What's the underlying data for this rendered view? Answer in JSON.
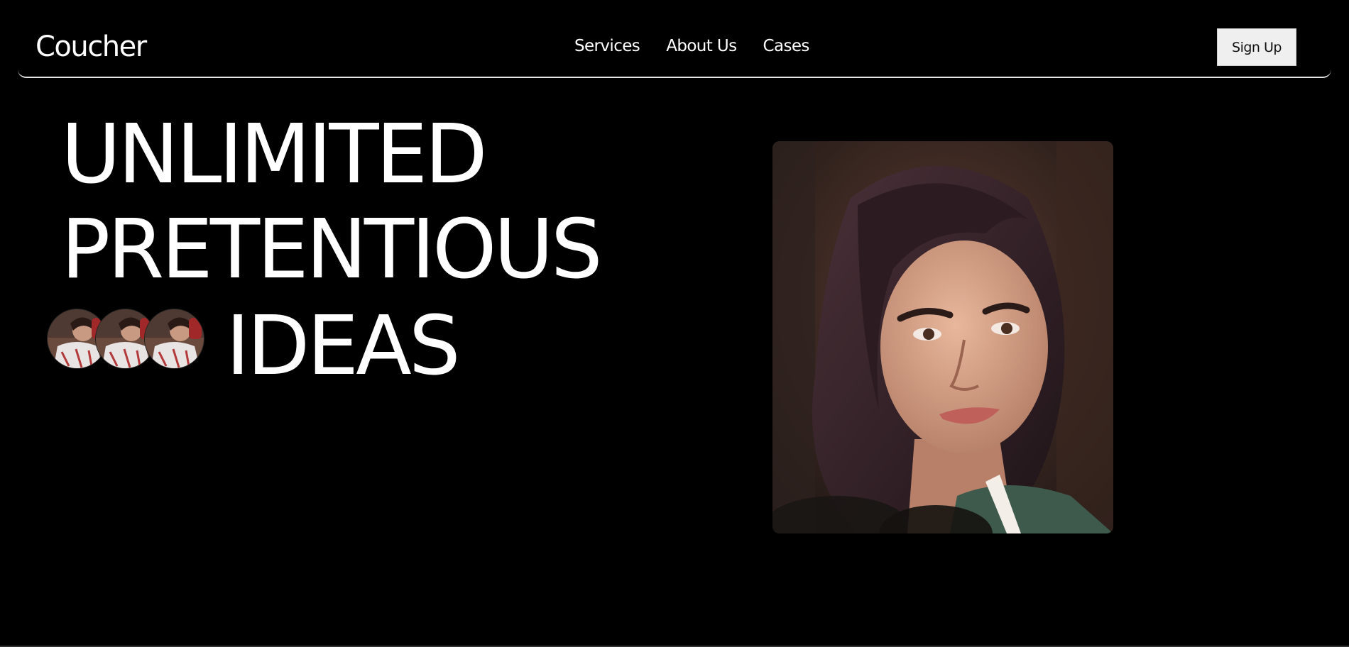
{
  "header": {
    "logo": "Coucher",
    "nav": [
      "Services",
      "About Us",
      "Cases"
    ],
    "signup_label": "Sign Up"
  },
  "hero": {
    "lines": [
      "UNLIMITED",
      "PRETENTIOUS",
      "IDEAS"
    ]
  },
  "colors": {
    "background": "#000000",
    "text": "#ffffff",
    "button_bg": "#efefef",
    "button_text": "#111111"
  }
}
